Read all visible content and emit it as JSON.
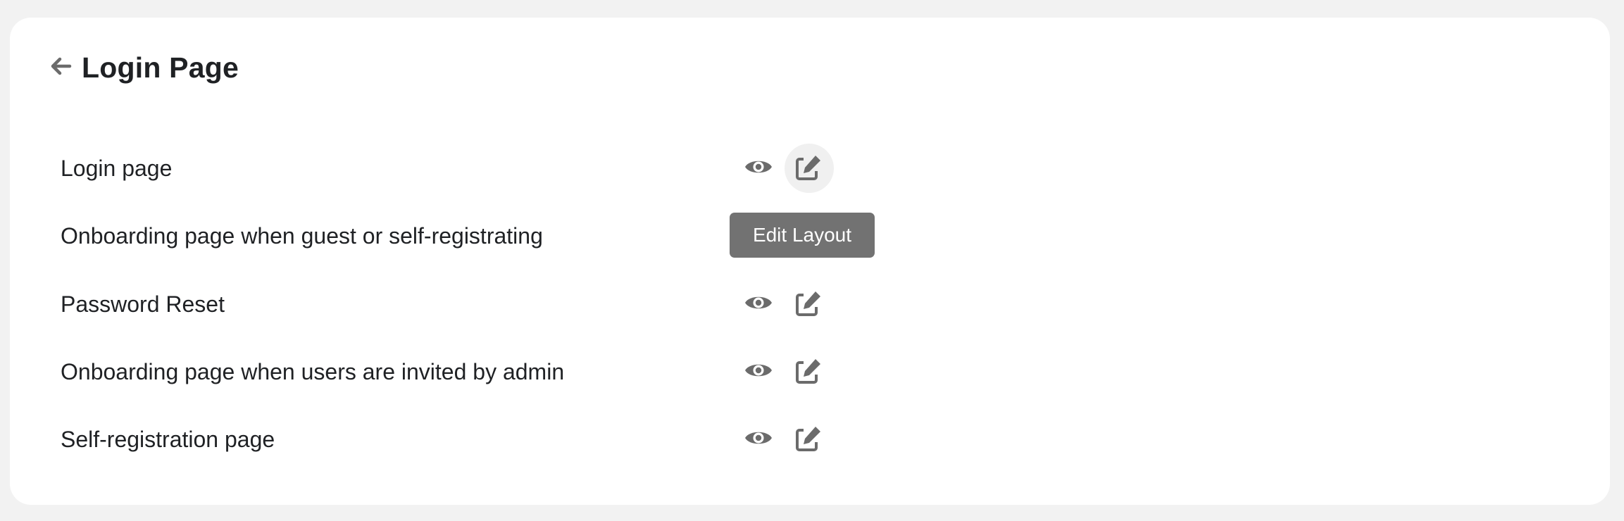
{
  "header": {
    "back_icon": "arrow-left-icon",
    "title": "Login Page"
  },
  "rows": [
    {
      "label": "Login page",
      "show_actions": true,
      "hovered_action": "edit"
    },
    {
      "label": "Onboarding page when guest or self-registrating",
      "show_actions": false
    },
    {
      "label": "Password Reset",
      "show_actions": true
    },
    {
      "label": "Onboarding page when users are invited by admin",
      "show_actions": true
    },
    {
      "label": "Self-registration page",
      "show_actions": true
    }
  ],
  "actions": {
    "preview_icon": "eye-icon",
    "edit_icon": "edit-icon"
  },
  "tooltip": {
    "text": "Edit Layout"
  },
  "colors": {
    "background": "#f2f2f2",
    "card": "#ffffff",
    "icon": "#6b6b6b",
    "text": "#1f2124",
    "tooltip_bg": "#727272",
    "hover_bg": "#f0f0f0"
  }
}
